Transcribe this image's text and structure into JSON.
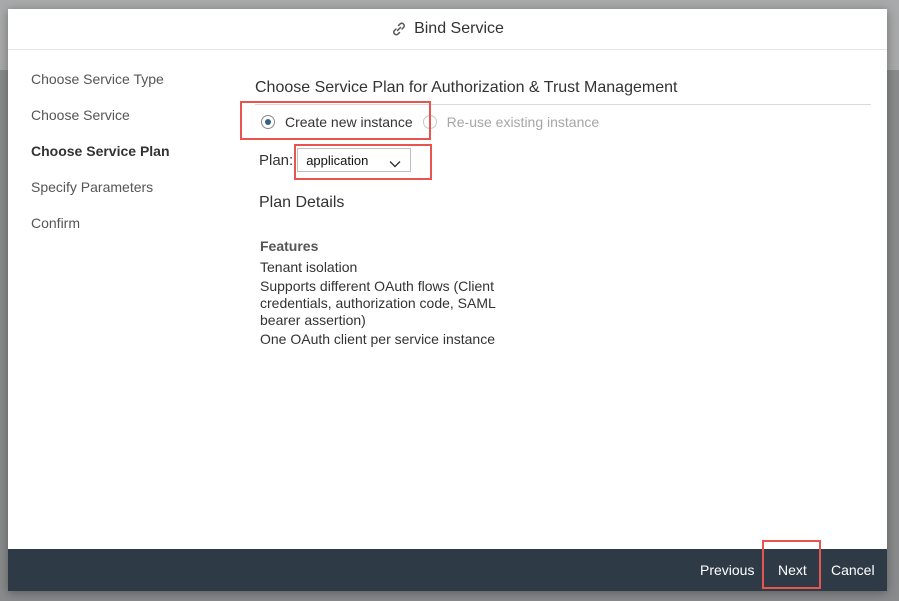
{
  "dialog": {
    "title": "Bind Service",
    "title_icon": "link-icon"
  },
  "sidebar": {
    "items": [
      {
        "label": "Choose Service Type"
      },
      {
        "label": "Choose Service"
      },
      {
        "label": "Choose Service Plan"
      },
      {
        "label": "Specify Parameters"
      },
      {
        "label": "Confirm"
      }
    ],
    "active_label": "Choose Service Plan"
  },
  "main": {
    "section_title": "Choose Service Plan for Authorization & Trust Management",
    "instance_options": {
      "create_label": "Create new instance",
      "reuse_label": "Re-use existing instance",
      "selected": "Create new instance"
    },
    "plan": {
      "label": "Plan:",
      "selected_value": "application"
    },
    "plan_details_heading": "Plan Details",
    "features_heading": "Features",
    "features": [
      "Tenant isolation",
      "Supports different OAuth flows (Client credentials, authorization code, SAML bearer assertion)",
      "One OAuth client per service instance"
    ]
  },
  "footer": {
    "previous_label": "Previous",
    "next_label": "Next",
    "cancel_label": "Cancel"
  },
  "colors": {
    "footer_bg": "#2f3a47",
    "highlight": "#e8554f",
    "radio_accent": "#346187"
  }
}
